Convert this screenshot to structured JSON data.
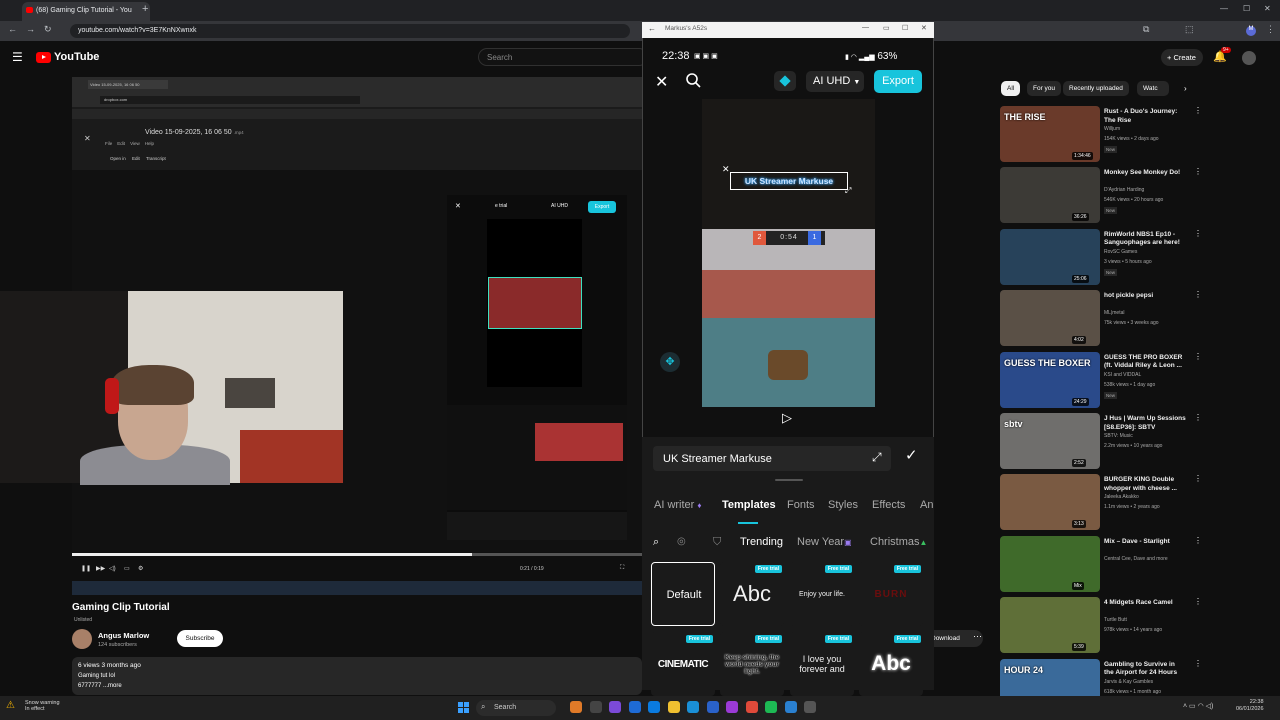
{
  "browser": {
    "tab_title": "(68) Gaming Clip Tutorial - You",
    "url": "youtube.com/watch?v=3E7KnNXwnxk",
    "new_tab": "+"
  },
  "youtube": {
    "logo_text": "YouTube",
    "search_placeholder": "Search",
    "create_label": "Create",
    "notifications_count": "9+",
    "chips": [
      "All",
      "For you",
      "Recently uploaded",
      "Watc"
    ]
  },
  "embedded_video": {
    "doc_title": "Video 15-09-2025, 16 06 50",
    "doc_ext": ".mp4",
    "dropbox_label": "dropbox.com",
    "menu": [
      "File",
      "Edit",
      "View",
      "Help"
    ],
    "menu2": [
      "Open in",
      "Edit",
      "Transcript"
    ],
    "editor_trial": "e trial",
    "editor_aiuhd": "AI UHD",
    "editor_export": "Export",
    "time": "0:21 / 0:19"
  },
  "video": {
    "title": "Gaming Clip Tutorial",
    "unlisted": "Unlisted",
    "channel": "Angus Marlow",
    "subscribers": "124 subscribers",
    "subscribe_label": "Subscribe",
    "stats": "6 views  3 months ago",
    "desc_line1": "Gaming tut lol",
    "desc_line2": "6777777  ...more",
    "download_label": "Download",
    "progress": 0.7
  },
  "recommendations": [
    {
      "title": "Rust - A Duo's Journey: The Rise",
      "channel": "Willjum",
      "views": "154K views • 2 days ago",
      "badge": "New",
      "duration": "1:34:46",
      "color": "#6a3a2a",
      "thumb_text": "THE RISE"
    },
    {
      "title": "Monkey See Monkey Do!",
      "channel": "D'Aydrian Harding",
      "views": "546K views • 20 hours ago",
      "badge": "New",
      "duration": "36:26",
      "color": "#3c3a36",
      "thumb_text": ""
    },
    {
      "title": "RimWorld NBS1 Ep10 - Sanguophages are here!",
      "channel": "RovSC Games",
      "views": "3 views • 5 hours ago",
      "badge": "New",
      "duration": "25:06",
      "color": "#27425a",
      "thumb_text": ""
    },
    {
      "title": "hot pickle pepsi",
      "channel": "ML|metal",
      "views": "75k views • 3 weeks ago",
      "badge": "",
      "duration": "4:02",
      "color": "#5a5046",
      "thumb_text": ""
    },
    {
      "title": "GUESS THE PRO BOXER (ft. Viddal Riley & Leon ...",
      "channel": "KSI and VIDDAL",
      "views": "538k views • 1 day ago",
      "badge": "New",
      "duration": "24:29",
      "color": "#2a4a8a",
      "thumb_text": "GUESS THE BOXER"
    },
    {
      "title": "J Hus | Warm Up Sessions [S8.EP36]: SBTV",
      "channel": "SBTV: Music",
      "views": "2.2m views • 10 years ago",
      "badge": "",
      "duration": "2:52",
      "color": "#6f6e6c",
      "thumb_text": "sbtv"
    },
    {
      "title": "BURGER KING Double whopper with cheese ...",
      "channel": "Jaleeka Akakko",
      "views": "1.1m views • 2 years ago",
      "badge": "",
      "duration": "3:13",
      "color": "#7a5a42",
      "thumb_text": ""
    },
    {
      "title": "Mix – Dave - Starlight",
      "channel": "Central Cee, Dave and more",
      "views": "",
      "badge": "",
      "duration": "Mix",
      "color": "#3f6a2a",
      "thumb_text": ""
    },
    {
      "title": "4 Midgets Race Camel",
      "channel": "Turtle Butt",
      "views": "978k views • 14 years ago",
      "badge": "",
      "duration": "5:39",
      "color": "#5f6f38",
      "thumb_text": ""
    },
    {
      "title": "Gambling to Survive in the Airport for 24 Hours",
      "channel": "Jarvis & Kay Gambles",
      "views": "618k views • 1 month ago",
      "badge": "",
      "duration": "",
      "color": "#3a6a9a",
      "thumb_text": "HOUR 24"
    }
  ],
  "phone": {
    "window_title": "Markus's A52s",
    "status_time": "22:38",
    "battery": "63%",
    "aiuhd_label": "AI UHD",
    "export_label": "Export",
    "textbox_text": "UK Streamer Markuse",
    "score_left": "2",
    "score_mid": "0:54",
    "score_right": "1",
    "text_input_value": "UK Streamer Markuse",
    "tabs": [
      "AI writer",
      "Templates",
      "Fonts",
      "Styles",
      "Effects",
      "An"
    ],
    "subtabs": [
      "Trending",
      "New Year",
      "Christmas"
    ],
    "free_trial": "Free trial",
    "templates_row1": [
      "Default",
      "Abc",
      "Enjoy your life.",
      "BURN"
    ],
    "templates_row2": [
      "CINEMATIC",
      "Keep shining, the world needs your light.",
      "I love you forever and",
      "Abc"
    ]
  },
  "taskbar": {
    "weather_l1": "Snow warning",
    "weather_l2": "In effect",
    "search_label": "Search",
    "time": "22:38",
    "date": "06/01/2026"
  }
}
